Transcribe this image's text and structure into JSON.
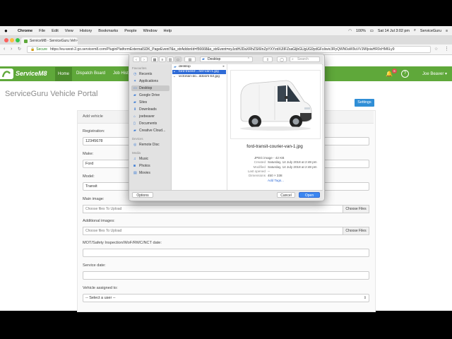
{
  "menubar": {
    "app": "Chrome",
    "items": [
      "File",
      "Edit",
      "View",
      "History",
      "Bookmarks",
      "People",
      "Window",
      "Help"
    ],
    "battery": "100%",
    "clock": "Sat 14 Jul  3:02 pm",
    "user_short": "ServiceGuru"
  },
  "browser": {
    "tab_title": "ServiceM8 - ServiceGuru Veh",
    "tab_close": "×",
    "url_secure": "Secure",
    "url": "https://eu-west-2.go.servicem8.com/PluginPlatformExternalSDK_PageEvent?&s_strAddonId=f56668&s_strEvent=eyJzdHJDaXRhZSI6InZpYXYzdXJlIFZsaGljbGUgUG9ydGFsIiwic3RyQWN0aW9uVVJMIjoiaHR0cHM6Ly9",
    "back": "‹",
    "forward": "›",
    "reload": "↻"
  },
  "app": {
    "logo": "ServiceM8",
    "nav": [
      "Home",
      "Dispatch Board",
      "Job Hist"
    ],
    "notification_count": "6",
    "help": "?",
    "user": "Joe Beaver ▾",
    "page_title": "ServiceGuru Vehicle Portal",
    "settings_label": "Settings",
    "panel_title": "Add vehicle"
  },
  "form": {
    "registration_label": "Registration:",
    "registration_value": "12345678",
    "make_label": "Make:",
    "make_value": "Ford",
    "model_label": "Model:",
    "model_value": "Transit",
    "main_image_label": "Main image:",
    "main_image_placeholder": "Choose files To Upload",
    "additional_images_label": "Additional images:",
    "additional_images_placeholder": "Choose files To Upload",
    "choose_files": "Choose Files",
    "mot_label": "MOT/Safety Inspection/WoF/RWC/NCT date:",
    "service_label": "Service date:",
    "assigned_label": "Vehicle assigned to:",
    "assigned_value": "-- Select a user --"
  },
  "dialog": {
    "location": "Desktop",
    "search_placeholder": "Search",
    "sidebar": {
      "favourites_header": "Favourites",
      "favourites": [
        "Recents",
        "Applications",
        "Desktop",
        "Google Drive",
        "Sites",
        "Downloads",
        "joebeaver",
        "Documents",
        "Creative Cloud..."
      ],
      "devices_header": "Devices",
      "devices": [
        "Remote Disc"
      ],
      "media_header": "Media",
      "media": [
        "Music",
        "Photos",
        "Movies"
      ]
    },
    "files": [
      "desktop",
      "ford-transit-...rier-van-1.jpg",
      "victorian-do...itdoors-b2.jpg"
    ],
    "preview": {
      "filename": "ford-transit-courier-van-1.jpg",
      "kind": "JPEG image - 42 KB",
      "created_label": "Created",
      "created": "Saturday, 14 July 2018 at 2:48 pm",
      "modified_label": "Modified",
      "modified": "Saturday, 14 July 2018 at 2:48 pm",
      "last_opened_label": "Last opened",
      "last_opened": "--",
      "dimensions_label": "Dimensions",
      "dimensions": "450 × 338",
      "add_tags": "Add Tags..."
    },
    "options": "Options",
    "cancel": "Cancel",
    "open": "Open"
  },
  "colors": {
    "brand_green": "#5fa83a",
    "accent_blue": "#2f8ed6",
    "selection_blue": "#2f6bd6"
  },
  "icons": [
    "apple-icon",
    "wifi-icon",
    "battery-icon",
    "search-icon",
    "bell-icon",
    "folder-icon",
    "lock-icon"
  ]
}
